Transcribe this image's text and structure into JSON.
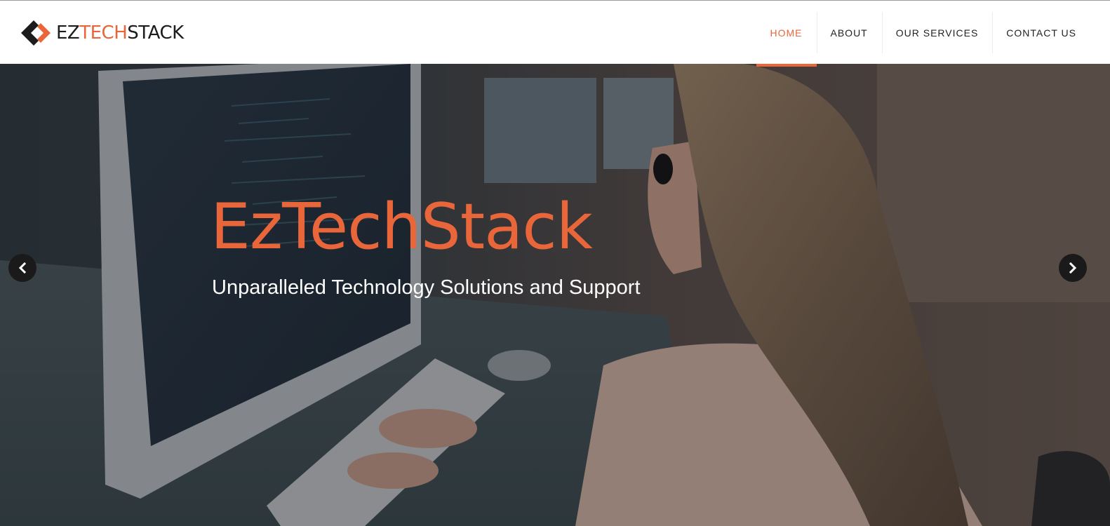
{
  "brand": {
    "logo_part1": "EZ",
    "logo_part2": "TECH",
    "logo_part3": "STACK",
    "accent_color": "#e8663a",
    "dark_color": "#1c1c1c"
  },
  "nav": {
    "items": [
      {
        "label": "HOME",
        "active": true
      },
      {
        "label": "ABOUT",
        "active": false
      },
      {
        "label": "OUR SERVICES",
        "active": false
      },
      {
        "label": "CONTACT US",
        "active": false
      }
    ]
  },
  "hero": {
    "title": "EzTechStack",
    "subtitle": "Unparalleled Technology Solutions and Support",
    "prev_icon": "chevron-left-icon",
    "next_icon": "chevron-right-icon"
  }
}
